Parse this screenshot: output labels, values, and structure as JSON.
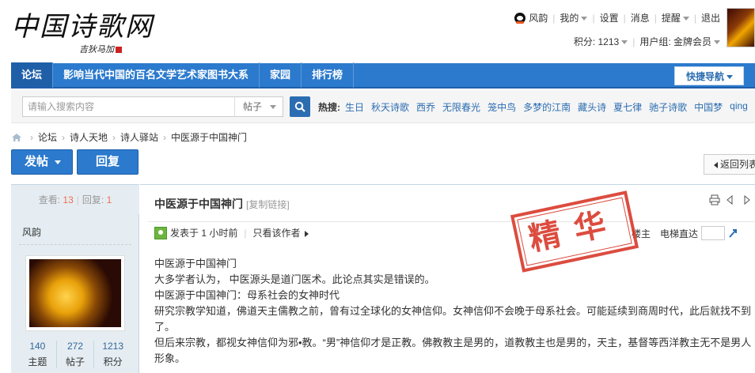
{
  "logo": {
    "title": "中国诗歌网",
    "sign": "吉狄马加"
  },
  "userbar": {
    "username": "风韵",
    "links": [
      "我的",
      "设置",
      "消息",
      "提醒",
      "退出"
    ],
    "points_label": "积分: 1213",
    "group_label": "用户组: 金牌会员"
  },
  "nav": {
    "items": [
      "论坛",
      "影响当代中国的百名文学艺术家图书大系",
      "家园",
      "排行榜"
    ],
    "quick_nav": "快捷导航"
  },
  "search": {
    "placeholder": "请输入搜索内容",
    "type": "帖子",
    "hot_label": "热搜:",
    "hot_terms": [
      "生日",
      "秋天诗歌",
      "西乔",
      "无限春光",
      "笼中鸟",
      "多梦的江南",
      "藏头诗",
      "夏七律",
      "驰子诗歌",
      "中国梦",
      "qing"
    ]
  },
  "breadcrumb": [
    "论坛",
    "诗人天地",
    "诗人驿站",
    "中医源于中国神门"
  ],
  "actions": {
    "post": "发帖",
    "reply": "回复",
    "back": "返回列表"
  },
  "thread": {
    "views_label": "查看:",
    "views": "13",
    "replies_label": "回复:",
    "replies": "1",
    "title": "中医源于中国神门",
    "copy_link": "[复制链接]",
    "stamp": "精华"
  },
  "author": {
    "name": "风韵",
    "stats": [
      {
        "value": "140",
        "label": "主题"
      },
      {
        "value": "272",
        "label": "帖子"
      },
      {
        "value": "1213",
        "label": "积分"
      }
    ]
  },
  "post": {
    "posted_at": "发表于 1 小时前",
    "only_author": "只看该作者",
    "floor": "楼主",
    "jump_label": "电梯直达",
    "lines": [
      "中医源于中国神门",
      "大多学者认为， 中医源头是道门医术。此论点其实是错误的。",
      "中医源于中国神门：母系社会的女神时代",
      "研究宗教学知道，佛道天主儒教之前，曾有过全球化的女神信仰。女神信仰不会晚于母系社会。可能延续到商周时代，此后就找不到了。",
      "但后来宗教，都视女神信仰为邪•教。“男”神信仰才是正教。佛教教主是男的，道教教主也是男的，天主，基督等西洋教主无不是男人形象。"
    ]
  }
}
